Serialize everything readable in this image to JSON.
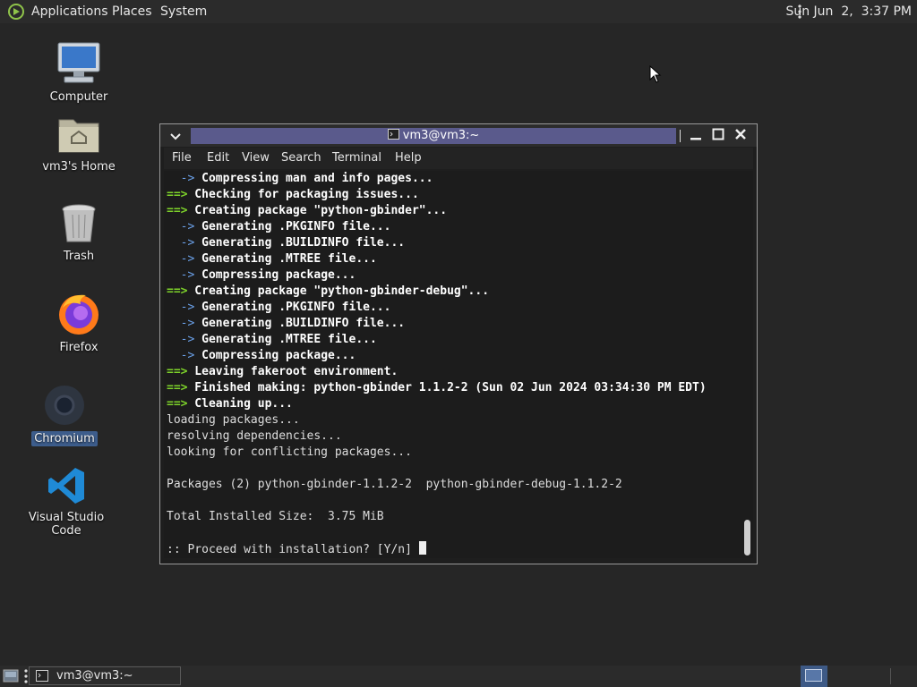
{
  "topbar": {
    "menus": [
      "Applications",
      "Places",
      "System"
    ],
    "clock": "Sun Jun  2,  3:37 PM"
  },
  "desktop_icons": [
    {
      "label": "Computer",
      "icon": "computer-icon"
    },
    {
      "label": "vm3's Home",
      "icon": "home-folder-icon"
    },
    {
      "label": "Trash",
      "icon": "trash-icon"
    },
    {
      "label": "Firefox",
      "icon": "firefox-icon"
    },
    {
      "label": "Chromium",
      "icon": "chromium-icon"
    },
    {
      "label": "Visual Studio Code",
      "icon": "vscode-icon"
    }
  ],
  "window": {
    "title": "vm3@vm3:~",
    "menus": [
      "File",
      "Edit",
      "View",
      "Search",
      "Terminal",
      "Help"
    ]
  },
  "terminal": {
    "lines": [
      {
        "p": "  ->",
        "t": " Compressing man and info pages...",
        "k": "arrow"
      },
      {
        "p": "==>",
        "t": " Checking for packaging issues...",
        "k": "main"
      },
      {
        "p": "==>",
        "t": " Creating package \"python-gbinder\"...",
        "k": "main"
      },
      {
        "p": "  ->",
        "t": " Generating .PKGINFO file...",
        "k": "arrow"
      },
      {
        "p": "  ->",
        "t": " Generating .BUILDINFO file...",
        "k": "arrow"
      },
      {
        "p": "  ->",
        "t": " Generating .MTREE file...",
        "k": "arrow"
      },
      {
        "p": "  ->",
        "t": " Compressing package...",
        "k": "arrow"
      },
      {
        "p": "==>",
        "t": " Creating package \"python-gbinder-debug\"...",
        "k": "main"
      },
      {
        "p": "  ->",
        "t": " Generating .PKGINFO file...",
        "k": "arrow"
      },
      {
        "p": "  ->",
        "t": " Generating .BUILDINFO file...",
        "k": "arrow"
      },
      {
        "p": "  ->",
        "t": " Generating .MTREE file...",
        "k": "arrow"
      },
      {
        "p": "  ->",
        "t": " Compressing package...",
        "k": "arrow"
      },
      {
        "p": "==>",
        "t": " Leaving fakeroot environment.",
        "k": "main"
      },
      {
        "p": "==>",
        "t": " Finished making: python-gbinder 1.1.2-2 (Sun 02 Jun 2024 03:34:30 PM EDT)",
        "k": "main"
      },
      {
        "p": "==>",
        "t": " Cleaning up...",
        "k": "main"
      },
      {
        "p": "",
        "t": "loading packages...",
        "k": "plain"
      },
      {
        "p": "",
        "t": "resolving dependencies...",
        "k": "plain"
      },
      {
        "p": "",
        "t": "looking for conflicting packages...",
        "k": "plain"
      },
      {
        "p": "",
        "t": "",
        "k": "plain"
      },
      {
        "p": "",
        "t": "Packages (2) python-gbinder-1.1.2-2  python-gbinder-debug-1.1.2-2",
        "k": "plain"
      },
      {
        "p": "",
        "t": "",
        "k": "plain"
      },
      {
        "p": "",
        "t": "Total Installed Size:  3.75 MiB",
        "k": "plain"
      },
      {
        "p": "",
        "t": "",
        "k": "plain"
      },
      {
        "p": "",
        "t": ":: Proceed with installation? [Y/n] ",
        "k": "prompt"
      }
    ]
  },
  "taskbar": {
    "task_label": "vm3@vm3:~"
  },
  "colors": {
    "arrow_green": "#7ed32a",
    "arrow_blue": "#6aa0e8",
    "title_band": "#5a5a8c",
    "selection": "#3d5d8c"
  }
}
